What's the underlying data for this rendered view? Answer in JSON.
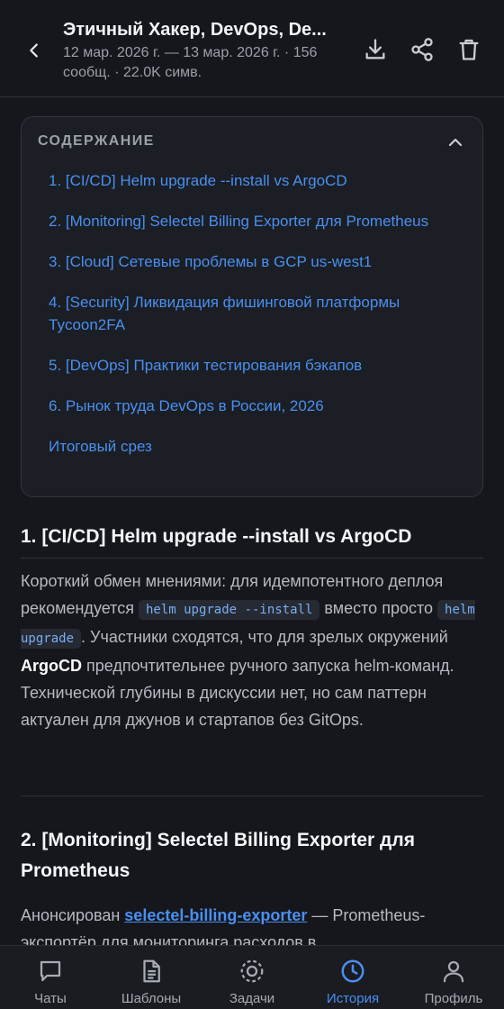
{
  "header": {
    "title": "Этичный Хакер, DevOps, De...",
    "subtitle": "12 мар. 2026 г. — 13 мар. 2026 г. · 156 сообщ. · 22.0K симв.",
    "icons": [
      "back-arrow-icon",
      "download-icon",
      "share-icon",
      "trash-icon"
    ]
  },
  "toc": {
    "heading": "СОДЕРЖАНИЕ",
    "items": [
      "1. [CI/CD] Helm upgrade --install vs ArgoCD",
      "2. [Monitoring] Selectel Billing Exporter для Prometheus",
      "3. [Cloud] Сетевые проблемы в GCP us-west1",
      "4. [Security] Ликвидация фишинговой платформы Tycoon2FA",
      "5. [DevOps] Практики тестирования бэкапов",
      "6. Рынок труда DevOps в России, 2026",
      "Итоговый срез"
    ]
  },
  "section1": {
    "title": "1. [CI/CD] Helm upgrade --install vs ArgoCD",
    "p_a": "Короткий обмен мнениями: для идемпотентного деплоя рекомендуется ",
    "code1": "helm upgrade --install",
    "p_b": " вместо просто ",
    "code2": "helm upgrade",
    "p_c": ". Участники сходятся, что для зрелых окружений ",
    "bold": "ArgoCD",
    "p_d": " предпочтительнее ручного запуска helm-команд. Технической глубины в дискуссии нет, но сам паттерн актуален для джунов и стартапов без GitOps."
  },
  "section2": {
    "title": "2. [Monitoring] Selectel Billing Exporter для Prometheus",
    "p_a": "Анонсирован ",
    "link": "selectel-billing-exporter",
    "p_b": " — Prometheus-экспортёр для мониторинга расходов в"
  },
  "nav": {
    "items": [
      {
        "label": "Чаты",
        "icon": "chat-icon",
        "active": false
      },
      {
        "label": "Шаблоны",
        "icon": "document-icon",
        "active": false
      },
      {
        "label": "Задачи",
        "icon": "target-icon",
        "active": false
      },
      {
        "label": "История",
        "icon": "clock-icon",
        "active": true
      },
      {
        "label": "Профиль",
        "icon": "user-icon",
        "active": false
      }
    ],
    "accent": "#4a8ff0"
  }
}
